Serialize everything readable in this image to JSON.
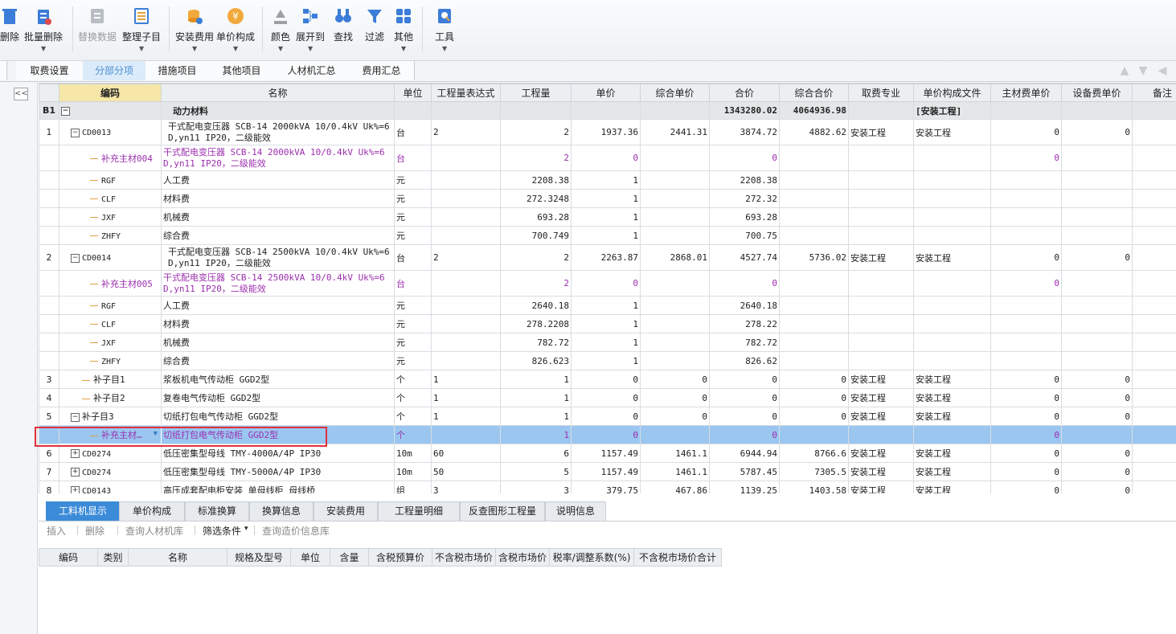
{
  "toolbar": {
    "buttons": [
      {
        "label": "删除",
        "icon": "delete-icon"
      },
      {
        "label": "批量删除",
        "icon": "batch-delete-icon"
      },
      {
        "label": "替换数据",
        "icon": "replace-data-icon"
      },
      {
        "label": "整理子目",
        "icon": "organize-subitems-icon"
      },
      {
        "label": "安装费用",
        "icon": "install-cost-icon"
      },
      {
        "label": "单价构成",
        "icon": "unit-price-composition-icon"
      },
      {
        "label": "颜色",
        "icon": "color-icon"
      },
      {
        "label": "展开到",
        "icon": "expand-to-icon"
      },
      {
        "label": "查找",
        "icon": "find-icon"
      },
      {
        "label": "过滤",
        "icon": "filter-icon"
      },
      {
        "label": "其他",
        "icon": "other-icon"
      },
      {
        "label": "工具",
        "icon": "tools-icon"
      }
    ]
  },
  "tabs": [
    "息",
    "取费设置",
    "分部分项",
    "措施项目",
    "其他项目",
    "人材机汇总",
    "费用汇总"
  ],
  "collapse_label": "<<",
  "grid": {
    "headers": [
      "",
      "编码",
      "名称",
      "单位",
      "工程量表达式",
      "工程量",
      "单价",
      "综合单价",
      "合价",
      "综合合价",
      "取费专业",
      "单价构成文件",
      "主材费单价",
      "设备费单价",
      "备注"
    ],
    "group": {
      "no": "B1",
      "name": "动力材料",
      "total": "1343280.02",
      "comp_total": "4064936.98",
      "file": "[安装工程]"
    },
    "rows": [
      {
        "type": "item",
        "no": "1",
        "code": "CD0013",
        "name": "干式配电变压器 SCB-14 2000kVA 10/0.4kV Uk%=6 D,yn11 IP20，二级能效",
        "unit": "台",
        "expr": "2",
        "qty": "2",
        "price": "1937.36",
        "cprice": "2441.31",
        "total": "3874.72",
        "ctotal": "4882.62",
        "spec": "安装工程",
        "file": "安装工程",
        "mat": "0",
        "equip": "0"
      },
      {
        "type": "purple",
        "code": "补充主材004",
        "name": "干式配电变压器 SCB-14 2000kVA 10/0.4kV Uk%=6 D,yn11 IP20，二级能效",
        "unit": "台",
        "qty": "2",
        "price": "0",
        "total": "0",
        "mat": "0"
      },
      {
        "type": "sub",
        "code": "RGF",
        "name": "人工费",
        "unit": "元",
        "qty": "2208.38",
        "price": "1",
        "total": "2208.38"
      },
      {
        "type": "sub",
        "code": "CLF",
        "name": "材料费",
        "unit": "元",
        "qty": "272.3248",
        "price": "1",
        "total": "272.32"
      },
      {
        "type": "sub",
        "code": "JXF",
        "name": "机械费",
        "unit": "元",
        "qty": "693.28",
        "price": "1",
        "total": "693.28"
      },
      {
        "type": "sub",
        "code": "ZHFY",
        "name": "综合费",
        "unit": "元",
        "qty": "700.749",
        "price": "1",
        "total": "700.75"
      },
      {
        "type": "item",
        "no": "2",
        "code": "CD0014",
        "name": "干式配电变压器 SCB-14 2500kVA 10/0.4kV Uk%=6 D,yn11 IP20，二级能效",
        "unit": "台",
        "expr": "2",
        "qty": "2",
        "price": "2263.87",
        "cprice": "2868.01",
        "total": "4527.74",
        "ctotal": "5736.02",
        "spec": "安装工程",
        "file": "安装工程",
        "mat": "0",
        "equip": "0"
      },
      {
        "type": "purple",
        "code": "补充主材005",
        "name": "干式配电变压器 SCB-14 2500kVA 10/0.4kV Uk%=6 D,yn11 IP20，二级能效",
        "unit": "台",
        "qty": "2",
        "price": "0",
        "total": "0",
        "mat": "0"
      },
      {
        "type": "sub",
        "code": "RGF",
        "name": "人工费",
        "unit": "元",
        "qty": "2640.18",
        "price": "1",
        "total": "2640.18"
      },
      {
        "type": "sub",
        "code": "CLF",
        "name": "材料费",
        "unit": "元",
        "qty": "278.2208",
        "price": "1",
        "total": "278.22"
      },
      {
        "type": "sub",
        "code": "JXF",
        "name": "机械费",
        "unit": "元",
        "qty": "782.72",
        "price": "1",
        "total": "782.72"
      },
      {
        "type": "sub",
        "code": "ZHFY",
        "name": "综合费",
        "unit": "元",
        "qty": "826.623",
        "price": "1",
        "total": "826.62"
      },
      {
        "type": "plain",
        "no": "3",
        "code": "补子目1",
        "name": "浆板机电气传动柜 GGD2型",
        "unit": "个",
        "expr": "1",
        "qty": "1",
        "price": "0",
        "cprice": "0",
        "total": "0",
        "ctotal": "0",
        "spec": "安装工程",
        "file": "安装工程",
        "mat": "0",
        "equip": "0"
      },
      {
        "type": "plain",
        "no": "4",
        "code": "补子目2",
        "name": "复卷电气传动柜 GGD2型",
        "unit": "个",
        "expr": "1",
        "qty": "1",
        "price": "0",
        "cprice": "0",
        "total": "0",
        "ctotal": "0",
        "spec": "安装工程",
        "file": "安装工程",
        "mat": "0",
        "equip": "0"
      },
      {
        "type": "minus",
        "no": "5",
        "code": "补子目3",
        "name": "切纸打包电气传动柜 GGD2型",
        "unit": "个",
        "expr": "1",
        "qty": "1",
        "price": "0",
        "cprice": "0",
        "total": "0",
        "ctotal": "0",
        "spec": "安装工程",
        "file": "安装工程",
        "mat": "0",
        "equip": "0"
      },
      {
        "type": "selected",
        "code": "补充主材…",
        "name": "切纸打包电气传动柜 GGD2型",
        "unit": "个",
        "qty": "1",
        "price": "0",
        "total": "0",
        "mat": "0"
      },
      {
        "type": "plus",
        "no": "6",
        "code": "CD0274",
        "name": "低压密集型母线 TMY-4000A/4P IP30",
        "unit": "10m",
        "expr": "60",
        "qty": "6",
        "price": "1157.49",
        "cprice": "1461.1",
        "total": "6944.94",
        "ctotal": "8766.6",
        "spec": "安装工程",
        "file": "安装工程",
        "mat": "0",
        "equip": "0"
      },
      {
        "type": "plus",
        "no": "7",
        "code": "CD0274",
        "name": "低压密集型母线 TMY-5000A/4P IP30",
        "unit": "10m",
        "expr": "50",
        "qty": "5",
        "price": "1157.49",
        "cprice": "1461.1",
        "total": "5787.45",
        "ctotal": "7305.5",
        "spec": "安装工程",
        "file": "安装工程",
        "mat": "0",
        "equip": "0"
      },
      {
        "type": "plus",
        "no": "8",
        "code": "CD0143",
        "name": "高压成套配电柜安装 单母线柜 母线桥",
        "unit": "组",
        "expr": "3",
        "qty": "3",
        "price": "379.75",
        "cprice": "467.86",
        "total": "1139.25",
        "ctotal": "1403.58",
        "spec": "安装工程",
        "file": "安装工程",
        "mat": "0",
        "equip": "0"
      }
    ]
  },
  "bottom": {
    "tabs": [
      "工料机显示",
      "单价构成",
      "标准换算",
      "换算信息",
      "安装费用",
      "工程量明细",
      "反查图形工程量",
      "说明信息"
    ],
    "actions": [
      "插入",
      "删除",
      "查询人材机库",
      "筛选条件",
      "查询造价信息库"
    ],
    "headers": [
      "编码",
      "类别",
      "名称",
      "规格及型号",
      "单位",
      "含量",
      "含税预算价",
      "不含税市场价",
      "含税市场价",
      "税率/调整系数(%)",
      "不含税市场价合计"
    ]
  }
}
